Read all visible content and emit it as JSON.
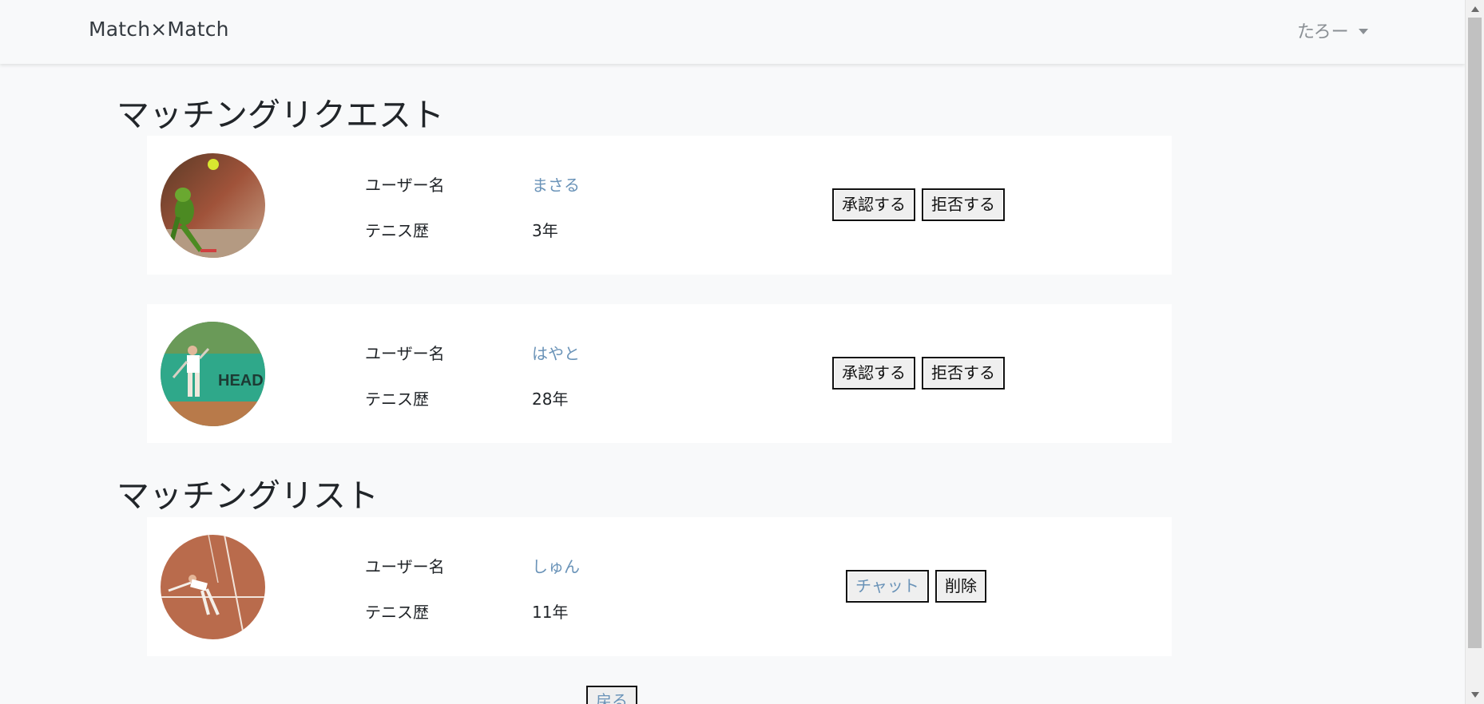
{
  "navbar": {
    "brand": "Match×Match",
    "user_name": "たろー"
  },
  "requests": {
    "title": "マッチングリクエスト",
    "items": [
      {
        "username_label": "ユーザー名",
        "username": "まさる",
        "tennis_label": "テニス歴",
        "tennis_years": "3年",
        "approve_label": "承認する",
        "reject_label": "拒否する",
        "avatar_icon": "frog-tennis-photo"
      },
      {
        "username_label": "ユーザー名",
        "username": "はやと",
        "tennis_label": "テニス歴",
        "tennis_years": "28年",
        "approve_label": "承認する",
        "reject_label": "拒否する",
        "avatar_icon": "tennis-player-photo"
      }
    ]
  },
  "matches": {
    "title": "マッチングリスト",
    "items": [
      {
        "username_label": "ユーザー名",
        "username": "しゅん",
        "tennis_label": "テニス歴",
        "tennis_years": "11年",
        "chat_label": "チャット",
        "delete_label": "削除",
        "avatar_icon": "clay-court-player-photo"
      }
    ]
  },
  "back_label": "戻る",
  "colors": {
    "background": "#f8f9fa",
    "card": "#ffffff",
    "link": "#6a93b8",
    "text": "#212529"
  }
}
